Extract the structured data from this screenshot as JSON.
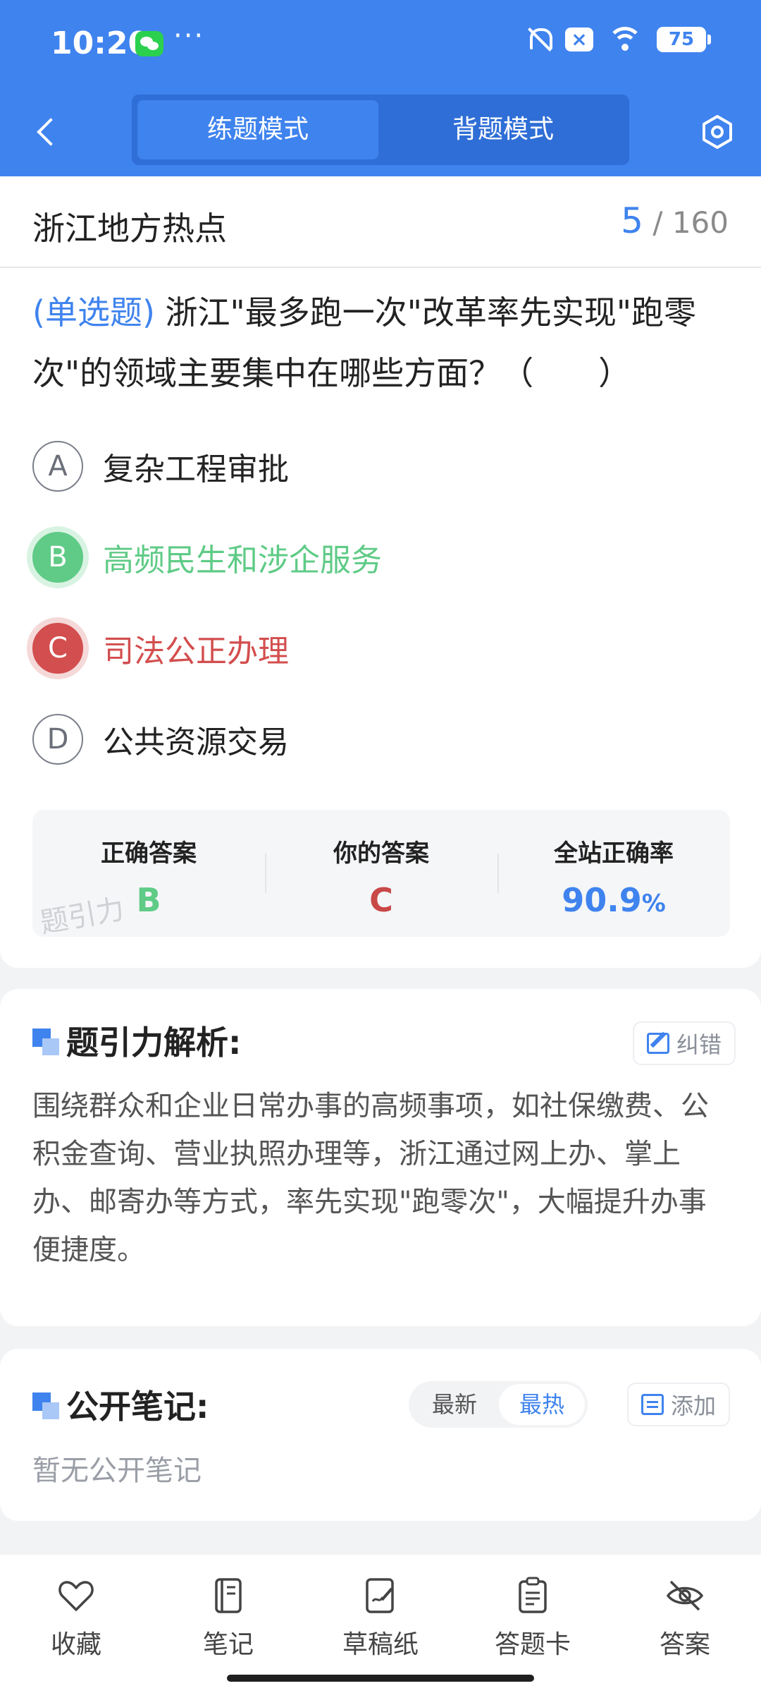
{
  "status_bar": {
    "time": "10:20",
    "dots": "···",
    "battery": "75"
  },
  "nav": {
    "tabs": [
      "练题模式",
      "背题模式"
    ],
    "active_tab": 0
  },
  "question": {
    "category": "浙江地方热点",
    "current": "5",
    "total": "160",
    "type_label": "(单选题)",
    "text": "浙江\"最多跑一次\"改革率先实现\"跑零次\"的领域主要集中在哪些方面？（　　）",
    "options": [
      {
        "letter": "A",
        "text": "复杂工程审批",
        "state": "normal"
      },
      {
        "letter": "B",
        "text": "高频民生和涉企服务",
        "state": "correct"
      },
      {
        "letter": "C",
        "text": "司法公正办理",
        "state": "wrong"
      },
      {
        "letter": "D",
        "text": "公共资源交易",
        "state": "normal"
      }
    ]
  },
  "summary": {
    "correct_label": "正确答案",
    "correct_value": "B",
    "yours_label": "你的答案",
    "yours_value": "C",
    "rate_label": "全站正确率",
    "rate_value": "90.9",
    "rate_unit": "%",
    "watermark": "题引力"
  },
  "analysis": {
    "title": "题引力解析:",
    "report_label": "纠错",
    "text": "围绕群众和企业日常办事的高频事项，如社保缴费、公积金查询、营业执照办理等，浙江通过网上办、掌上办、邮寄办等方式，率先实现\"跑零次\"，大幅提升办事便捷度。"
  },
  "notes": {
    "title": "公开笔记:",
    "sort_latest": "最新",
    "sort_hot": "最热",
    "add_label": "添加",
    "empty_text": "暂无公开笔记"
  },
  "bottom_bar": {
    "items": [
      {
        "label": "收藏",
        "icon": "heart-icon"
      },
      {
        "label": "笔记",
        "icon": "notebook-icon"
      },
      {
        "label": "草稿纸",
        "icon": "draft-paper-icon"
      },
      {
        "label": "答题卡",
        "icon": "answer-sheet-icon"
      },
      {
        "label": "答案",
        "icon": "eye-off-icon"
      }
    ]
  },
  "colors": {
    "primary": "#3f83ee",
    "correct": "#5fcb86",
    "wrong": "#d34e4e"
  }
}
